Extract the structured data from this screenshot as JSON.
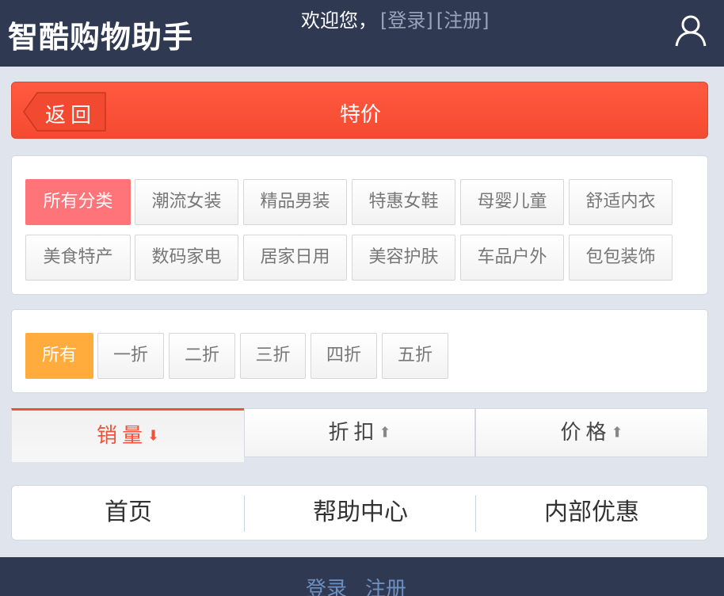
{
  "header": {
    "logo": "智酷购物助手",
    "welcome": "欢迎您，",
    "login_link": "[登录]",
    "register_link": "[注册]"
  },
  "titlebar": {
    "back_label": "返回",
    "title": "特价"
  },
  "categories": [
    "所有分类",
    "潮流女装",
    "精品男装",
    "特惠女鞋",
    "母婴儿童",
    "舒适内衣",
    "美食特产",
    "数码家电",
    "居家日用",
    "美容护肤",
    "车品户外",
    "包包装饰"
  ],
  "discounts": [
    "所有",
    "一折",
    "二折",
    "三折",
    "四折",
    "五折"
  ],
  "sort": {
    "sales": "销量",
    "discount": "折扣",
    "price": "价格",
    "down_arrow": "⬇",
    "up_arrow": "⬆"
  },
  "footnav": {
    "home": "首页",
    "help": "帮助中心",
    "internal": "内部优惠"
  },
  "bottombar": {
    "login": "登录",
    "register": "注册"
  },
  "colors": {
    "header_bg": "#2f3951",
    "title_red": "#f54a31",
    "active_category": "#ff7478",
    "active_discount": "#ffac3d",
    "link_blue": "#6d8fc0"
  }
}
